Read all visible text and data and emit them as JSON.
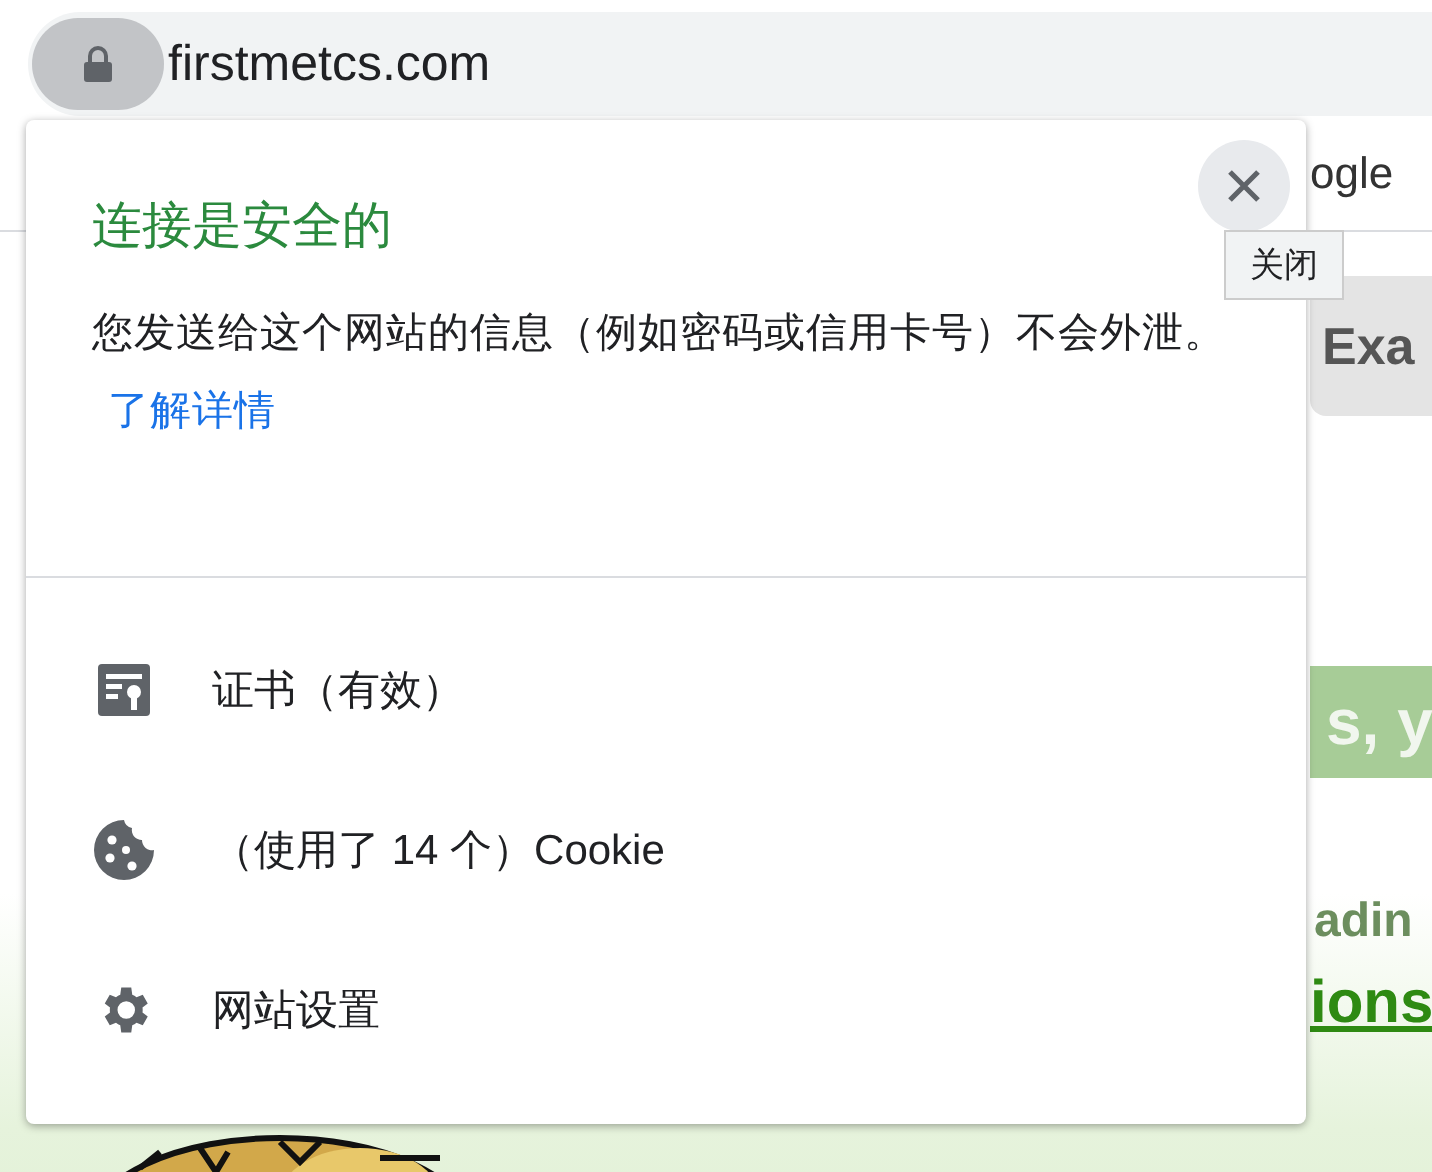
{
  "address_bar": {
    "url": "firstmetcs.com"
  },
  "background_page": {
    "bookmark_right": "ogle",
    "button": "Exa",
    "banner": "s, y",
    "subheading": "adin",
    "link": "ions"
  },
  "popup": {
    "title": "连接是安全的",
    "description": "您发送给这个网站的信息（例如密码或信用卡号）不会外泄。",
    "learn_more": "了解详情",
    "close_tooltip": "关闭",
    "items": [
      {
        "kind": "certificate",
        "label": "证书（有效）"
      },
      {
        "kind": "cookies",
        "label": "（使用了 14 个）Cookie"
      },
      {
        "kind": "settings",
        "label": "网站设置"
      }
    ]
  }
}
